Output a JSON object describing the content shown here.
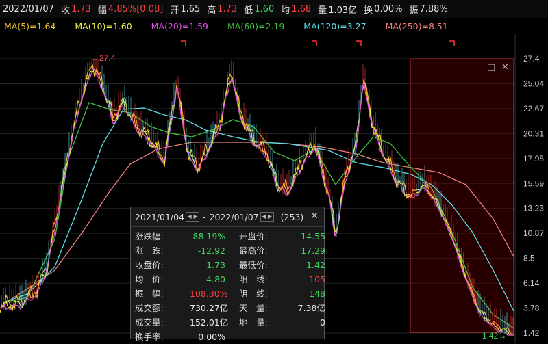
{
  "header": {
    "date": "2022/01/07",
    "close_label": "收",
    "close_value": "1.73",
    "change_label": "幅",
    "change_value": "4.85%[0.08]",
    "open_label": "开",
    "open_value": "1.65",
    "high_label": "高",
    "high_value": "1.73",
    "low_label": "低",
    "low_value": "1.60",
    "avg_label": "均",
    "avg_value": "1.68",
    "vol_label": "量",
    "vol_value": "1.03亿",
    "turnover_label": "换",
    "turnover_value": "0.00%",
    "amp_label": "振",
    "amp_value": "7.88%"
  },
  "ma": [
    {
      "text": "MA(5)=1.64",
      "color": "#f2c232"
    },
    {
      "text": "MA(10)=1.60",
      "color": "#f0f04a"
    },
    {
      "text": "MA(20)=1.59",
      "color": "#e050e0"
    },
    {
      "text": "MA(60)=2.19",
      "color": "#3fc43f"
    },
    {
      "text": "MA(120)=3.27",
      "color": "#5fe0e8"
    },
    {
      "text": "MA(250)=8.51",
      "color": "#f08080"
    }
  ],
  "chart": {
    "max_label": "←27.4",
    "min_label": "1.42→",
    "price_axis": [
      "27.4",
      "25.04",
      "22.67",
      "20.31",
      "17.95",
      "15.59",
      "13.23",
      "10.87",
      "8.5",
      "6.14",
      "3.78",
      "1.42"
    ],
    "restore_icon": "□",
    "close_icon": "✕"
  },
  "chart_data": {
    "type": "line",
    "x": [
      "2021/01/04",
      "2022/01/07"
    ],
    "ylim": [
      1.42,
      27.4
    ],
    "max_point": 27.4,
    "min_point": 1.42
  },
  "popup": {
    "range_start": "2021/01/04",
    "range_sep": "-",
    "range_end": "2022/01/07",
    "count": "(253)",
    "close": "✕",
    "rows": [
      {
        "k1": "涨跌幅:",
        "v1": "-88.19%",
        "c1": "#3fd85f",
        "k2": "开盘价:",
        "v2": "14.55",
        "c2": "#3fd85f"
      },
      {
        "k1": "涨　跌:",
        "v1": "-12.92",
        "c1": "#3fd85f",
        "k2": "最高价:",
        "v2": "17.29",
        "c2": "#3fd85f"
      },
      {
        "k1": "收盘价:",
        "v1": "1.73",
        "c1": "#3fd85f",
        "k2": "最低价:",
        "v2": "1.42",
        "c2": "#3fd85f"
      },
      {
        "k1": "均　价:",
        "v1": "4.80",
        "c1": "#3fd85f",
        "k2": "阳　线:",
        "v2": "105",
        "c2": "#ff4040"
      },
      {
        "k1": "振　幅:",
        "v1": "108.30%",
        "c1": "#ff4040",
        "k2": "阴　线:",
        "v2": "148",
        "c2": "#3fd85f"
      },
      {
        "k1": "成交额:",
        "v1": "730.27亿",
        "c1": "#e8e8e8",
        "k2": "天　量:",
        "v2": "7.38亿",
        "c2": "#e8e8e8"
      },
      {
        "k1": "成交量:",
        "v1": "152.01亿",
        "c1": "#e8e8e8",
        "k2": "地　量:",
        "v2": "0",
        "c2": "#e8e8e8"
      },
      {
        "k1": "换手率:",
        "v1": "0.00%",
        "c1": "#e8e8e8",
        "k2": "",
        "v2": "",
        "c2": "#e8e8e8"
      }
    ]
  }
}
